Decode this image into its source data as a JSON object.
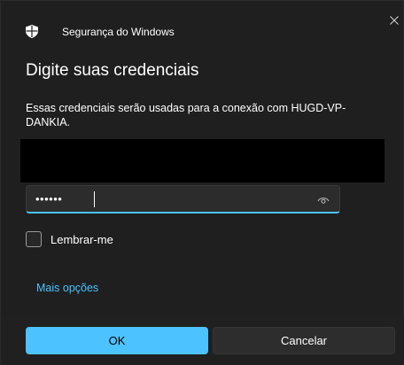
{
  "window": {
    "app_title": "Segurança do Windows",
    "app_icon": "shield-icon",
    "close_icon": "close-icon"
  },
  "dialog": {
    "heading": "Digite suas credenciais",
    "description": "Essas credenciais serão usadas para a conexão com HUGD-VP-DANKIA."
  },
  "fields": {
    "username": {
      "value": ""
    },
    "password": {
      "masked_value": "••••••",
      "reveal_icon": "eye-icon"
    }
  },
  "remember": {
    "label": "Lembrar-me",
    "checked": false
  },
  "links": {
    "more_options": "Mais opções"
  },
  "buttons": {
    "ok": "OK",
    "cancel": "Cancelar"
  },
  "colors": {
    "accent": "#4cc2ff",
    "background": "#1f1f1f",
    "footer": "#202020"
  }
}
